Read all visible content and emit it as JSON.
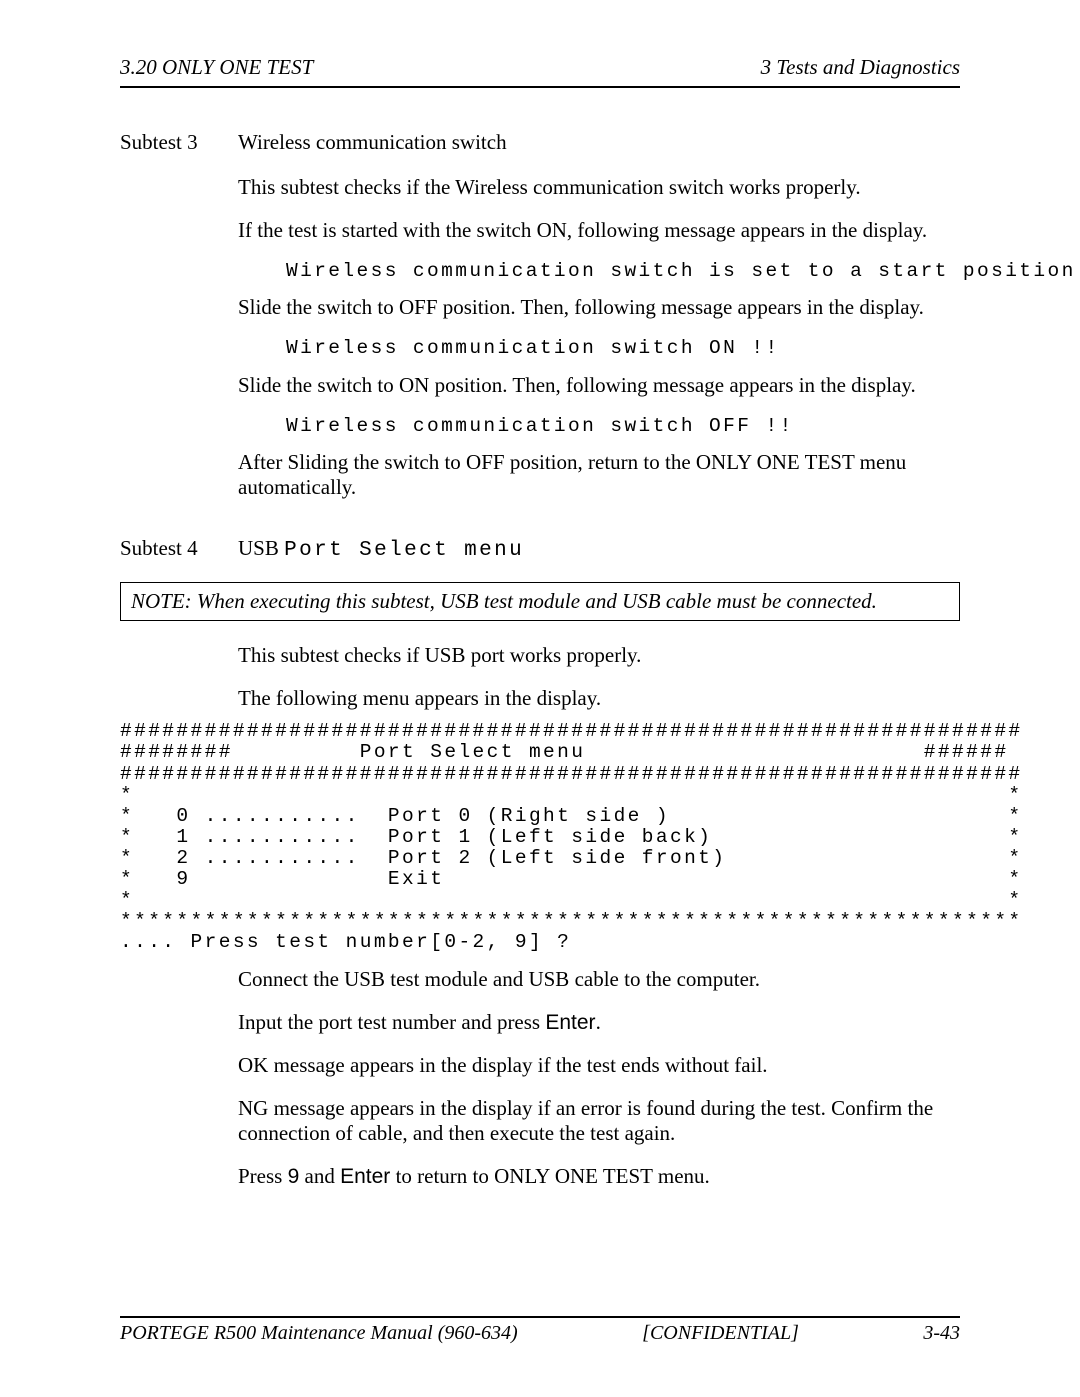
{
  "header": {
    "left": "3.20 ONLY ONE TEST",
    "right": "3  Tests and Diagnostics"
  },
  "subtest3": {
    "label": "Subtest 3",
    "title": "Wireless communication switch",
    "p1": "This subtest checks if the Wireless communication switch works properly.",
    "p2": "If the test is started with the switch ON, following message appears in the display.",
    "code1": "Wireless communication switch is set to a start position (OFF)",
    "p3": "Slide the switch to OFF position. Then, following message appears in the display.",
    "code2": "Wireless communication switch ON !!",
    "p4": "Slide the switch to ON position. Then, following message appears in the display.",
    "code3": "Wireless communication switch OFF !!",
    "p5": "After Sliding the switch to OFF position, return to the ONLY ONE TEST menu automatically."
  },
  "subtest4": {
    "label": "Subtest 4",
    "title_prefix": "USB ",
    "title_mono": "Port Select menu",
    "note": "NOTE:  When executing this subtest, USB test module and USB cable must be connected.",
    "p1": "This subtest checks if USB port works properly.",
    "p2": "The following menu appears in the display.",
    "menu": "################################################################\n########         Port Select menu                        ######\n################################################################\n*                                                              *\n*   0 ...........  Port 0 (Right side )                        *\n*   1 ...........  Port 1 (Left side back)                     *\n*   2 ...........  Port 2 (Left side front)                    *\n*   9              Exit                                        *\n*                                                              *\n****************************************************************\n.... Press test number[0-2, 9] ?",
    "p3": "Connect the USB test module and USB cable to the computer.",
    "p4_a": "Input the port test number and press ",
    "p4_b": "Enter",
    "p4_c": ".",
    "p5": "OK message appears in the display if the test ends without fail.",
    "p6": "NG message appears in the display if an error is found during the test. Confirm the connection of cable, and then execute the test again.",
    "p7_a": "Press ",
    "p7_b": "9",
    "p7_c": " and ",
    "p7_d": "Enter",
    "p7_e": " to return to ONLY ONE TEST menu."
  },
  "footer": {
    "left": "PORTEGE R500 Maintenance Manual (960-634)",
    "center": "[CONFIDENTIAL]",
    "right": "3-43"
  }
}
